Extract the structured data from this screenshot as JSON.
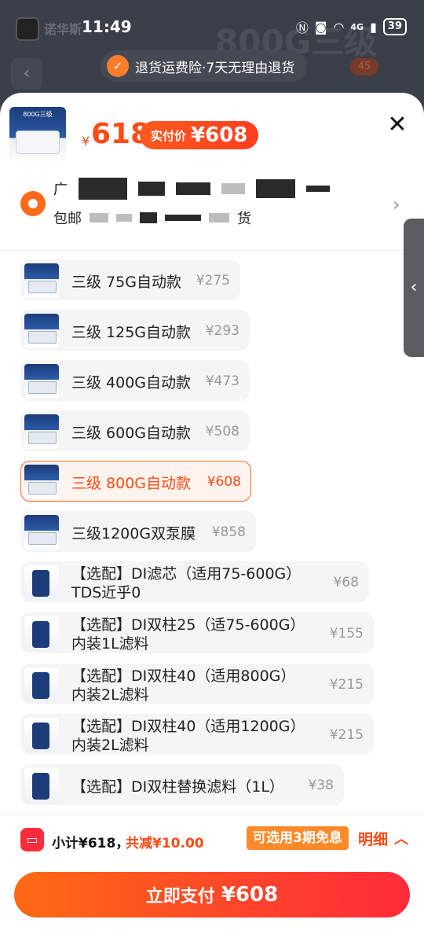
{
  "status_bar": {
    "time": "11:49",
    "network": "4G",
    "battery": "39"
  },
  "background": {
    "brand": "诺华斯",
    "banner": "800G三级",
    "cart_badge": "45"
  },
  "insurance": {
    "icon": "shield-check-icon",
    "text": "退货运费险·7天无理由退货"
  },
  "header": {
    "thumb_label": "800G三级",
    "currency": "¥",
    "price": "618",
    "actual_label": "实付价",
    "actual_price": "¥608",
    "close_icon": "✕"
  },
  "address": {
    "prefix": "广",
    "shipping_prefix": "包邮",
    "shipping_suffix": "货"
  },
  "options": [
    {
      "name": "三级 75G自动款",
      "name2": "",
      "price": "¥275",
      "selected": false,
      "kind": "machine"
    },
    {
      "name": "三级 125G自动款",
      "name2": "",
      "price": "¥293",
      "selected": false,
      "kind": "machine"
    },
    {
      "name": "三级 400G自动款",
      "name2": "",
      "price": "¥473",
      "selected": false,
      "kind": "machine"
    },
    {
      "name": "三级 600G自动款",
      "name2": "",
      "price": "¥508",
      "selected": false,
      "kind": "machine"
    },
    {
      "name": "三级 800G自动款",
      "name2": "",
      "price": "¥608",
      "selected": true,
      "kind": "machine"
    },
    {
      "name": "三级1200G双泵膜",
      "name2": "",
      "price": "¥858",
      "selected": false,
      "kind": "machine"
    },
    {
      "name": "【选配】DI滤芯（适用75-600G）",
      "name2": "TDS近乎0",
      "price": "¥68",
      "selected": false,
      "kind": "filter"
    },
    {
      "name": "【选配】DI双柱25（适75-600G）",
      "name2": "内装1L滤料",
      "price": "¥155",
      "selected": false,
      "kind": "filter"
    },
    {
      "name": "【选配】DI双柱40（适用800G）",
      "name2": "内装2L滤料",
      "price": "¥215",
      "selected": false,
      "kind": "filter"
    },
    {
      "name": "【选配】DI双柱40（适用1200G）",
      "name2": "内装2L滤料",
      "price": "¥215",
      "selected": false,
      "kind": "filter"
    },
    {
      "name": "【选配】DI双柱替换滤料（1L）",
      "name2": "",
      "price": "¥38",
      "selected": false,
      "kind": "filter"
    }
  ],
  "footer": {
    "subtotal": "小计¥618，",
    "discount": "共减¥10.00",
    "installment": "可选用3期免息",
    "detail": "明细",
    "pay_label": "立即支付",
    "pay_amount": "¥608"
  }
}
